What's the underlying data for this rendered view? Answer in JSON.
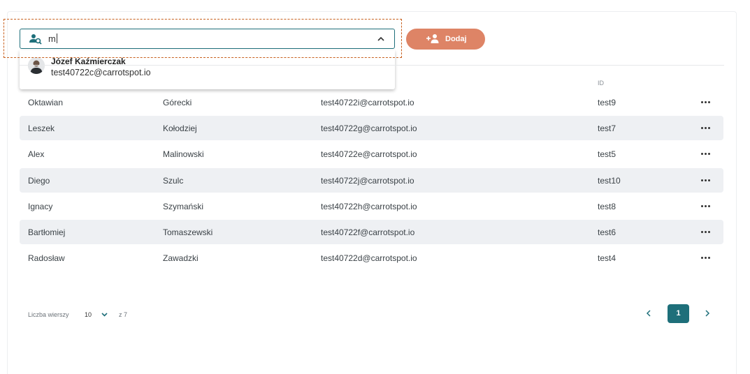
{
  "search": {
    "value": "m",
    "suggestions": [
      {
        "name": "Józef Kaźmierczak",
        "email": "test40722c@carrotspot.io"
      }
    ]
  },
  "toolbar": {
    "add_label": "Dodaj"
  },
  "table": {
    "id_header": "ID",
    "rows": [
      {
        "first": "Oktawian",
        "last": "Górecki",
        "email": "test40722i@carrotspot.io",
        "id": "test9"
      },
      {
        "first": "Leszek",
        "last": "Kołodziej",
        "email": "test40722g@carrotspot.io",
        "id": "test7"
      },
      {
        "first": "Alex",
        "last": "Malinowski",
        "email": "test40722e@carrotspot.io",
        "id": "test5"
      },
      {
        "first": "Diego",
        "last": "Szulc",
        "email": "test40722j@carrotspot.io",
        "id": "test10"
      },
      {
        "first": "Ignacy",
        "last": "Szymański",
        "email": "test40722h@carrotspot.io",
        "id": "test8"
      },
      {
        "first": "Bartłomiej",
        "last": "Tomaszewski",
        "email": "test40722f@carrotspot.io",
        "id": "test6"
      },
      {
        "first": "Radosław",
        "last": "Zawadzki",
        "email": "test40722d@carrotspot.io",
        "id": "test4"
      }
    ]
  },
  "pagination": {
    "rows_label": "Liczba wierszy",
    "rows_value": "10",
    "of_label": "z 7",
    "current_page": "1"
  },
  "colors": {
    "primary": "#1e6f7a",
    "accent": "#de8466",
    "focus_outline": "#c8601e",
    "row_alt": "#eef0f3"
  }
}
